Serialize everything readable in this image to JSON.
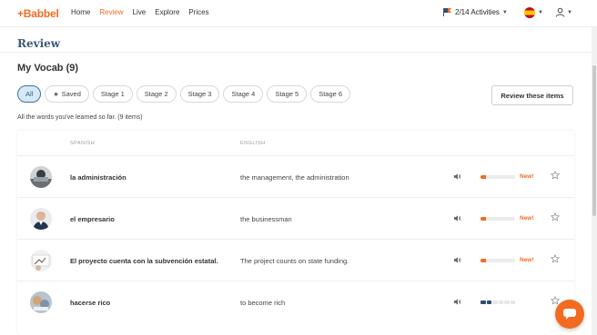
{
  "brand": {
    "logo": "+Babbel",
    "accent": "#f26b21",
    "navy": "#3d5878"
  },
  "nav": {
    "items": [
      {
        "label": "Home",
        "active": false
      },
      {
        "label": "Review",
        "active": true
      },
      {
        "label": "Live",
        "active": false
      },
      {
        "label": "Explore",
        "active": false
      },
      {
        "label": "Prices",
        "active": false
      }
    ],
    "activities": "2/14 Activities"
  },
  "page": {
    "section_title": "Review",
    "vocab_title": "My Vocab (9)",
    "filters": [
      "All",
      "Saved",
      "Stage 1",
      "Stage 2",
      "Stage 3",
      "Stage 4",
      "Stage 5",
      "Stage 6"
    ],
    "active_filter": "All",
    "review_button": "Review these items",
    "subtitle": "All the words you've learned so far. (9 items)"
  },
  "table": {
    "headers": {
      "source": "SPANISH",
      "target": "ENGLISH"
    },
    "rows": [
      {
        "term": "la administración",
        "translation": "the management, the administration",
        "progress": 0.15,
        "badge": "New!"
      },
      {
        "term": "el empresario",
        "translation": "the businessman",
        "progress": 0.15,
        "badge": "New!"
      },
      {
        "term": "El proyecto cuenta con la subvención estatal.",
        "translation": "The project counts on state funding.",
        "progress": 0.15,
        "badge": "New!"
      },
      {
        "term": "hacerse rico",
        "translation": "to become rich",
        "stage_segments_filled": 2,
        "stage_segments_total": 6,
        "badge": ""
      }
    ]
  }
}
